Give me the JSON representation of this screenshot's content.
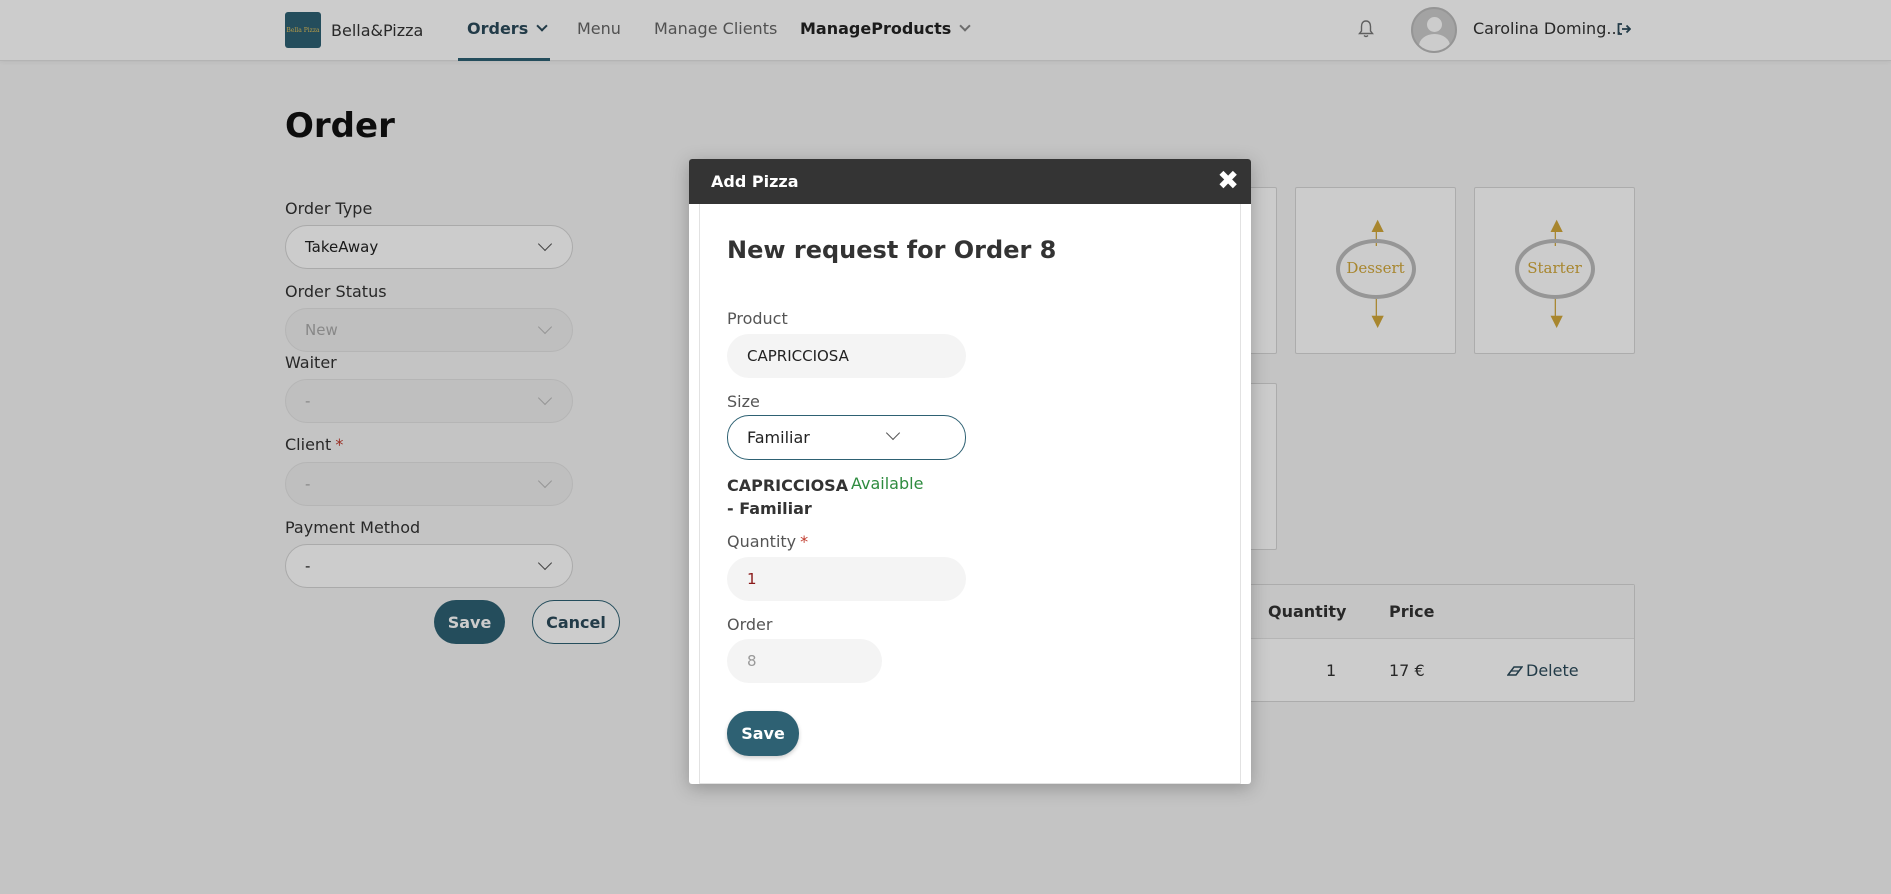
{
  "brand": {
    "logo_text": "Bella Pizza",
    "name": "Bella&Pizza"
  },
  "nav": {
    "orders": "Orders",
    "menu": "Menu",
    "manage_clients": "Manage Clients",
    "manage_products": "ManageProducts"
  },
  "user": {
    "name": "Carolina Doming..."
  },
  "page": {
    "title": "Order",
    "order_type_label": "Order Type",
    "order_type_value": "TakeAway",
    "order_status_label": "Order Status",
    "order_status_value": "New",
    "waiter_label": "Waiter",
    "waiter_value": "-",
    "client_label": "Client",
    "client_required": "*",
    "client_value": "-",
    "payment_label": "Payment Method",
    "payment_value": "-",
    "save_label": "Save",
    "cancel_label": "Cancel"
  },
  "categories": [
    {
      "label": "Dessert"
    },
    {
      "label": "Starter"
    }
  ],
  "table": {
    "headers": {
      "quantity": "Quantity",
      "price": "Price"
    },
    "rows": [
      {
        "quantity": "1",
        "price": "17 €",
        "action": "Delete"
      }
    ]
  },
  "modal": {
    "title": "Add Pizza",
    "close": "✖",
    "heading": "New request for Order 8",
    "product_label": "Product",
    "product_value": "CAPRICCIOSA",
    "size_label": "Size",
    "size_value": "Familiar",
    "availability_name": "CAPRICCIOSA - Familiar",
    "availability_status": "Available",
    "quantity_label": "Quantity",
    "quantity_required": "*",
    "quantity_value": "1",
    "order_label": "Order",
    "order_value": "8",
    "save_label": "Save"
  },
  "colors": {
    "primary": "#2e6173",
    "modal_header": "#343434",
    "available": "#2e8b3f",
    "required": "#c0392b"
  }
}
